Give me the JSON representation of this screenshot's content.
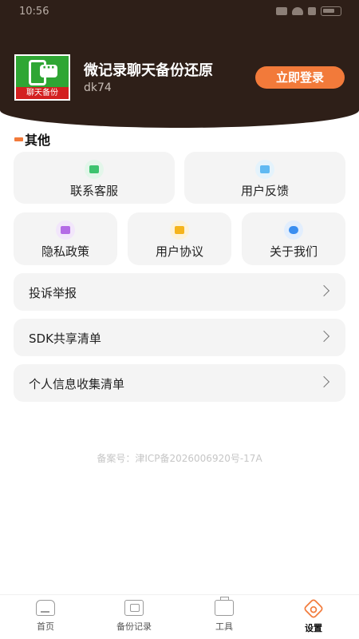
{
  "status_bar": {
    "time": "10:56"
  },
  "header": {
    "app_name": "微记录聊天备份还原",
    "user_id": "dk74",
    "login_button": "立即登录",
    "logo_text": "聊天备份"
  },
  "section": {
    "title": "其他"
  },
  "cards": [
    {
      "label": "联系客服",
      "icon": "chat-icon",
      "color": "#3cc36e"
    },
    {
      "label": "用户反馈",
      "icon": "mail-icon",
      "color": "#5fb9f2"
    },
    {
      "label": "隐私政策",
      "icon": "lock-icon",
      "color": "#b46ae6"
    },
    {
      "label": "用户协议",
      "icon": "document-icon",
      "color": "#f5b41c"
    },
    {
      "label": "关于我们",
      "icon": "info-icon",
      "color": "#3a8ef0"
    }
  ],
  "list": [
    {
      "label": "投诉举报"
    },
    {
      "label": "SDK共享清单"
    },
    {
      "label": "个人信息收集清单"
    }
  ],
  "icp": "备案号：津ICP备2026006920号-17A",
  "tabs": [
    {
      "label": "首页",
      "icon": "home-icon"
    },
    {
      "label": "备份记录",
      "icon": "backup-icon"
    },
    {
      "label": "工具",
      "icon": "toolbox-icon"
    },
    {
      "label": "设置",
      "icon": "settings-icon",
      "active": true
    }
  ],
  "colors": {
    "accent": "#f27a3a",
    "header_bg": "#2e1f18",
    "card_bg": "#f4f4f4"
  }
}
